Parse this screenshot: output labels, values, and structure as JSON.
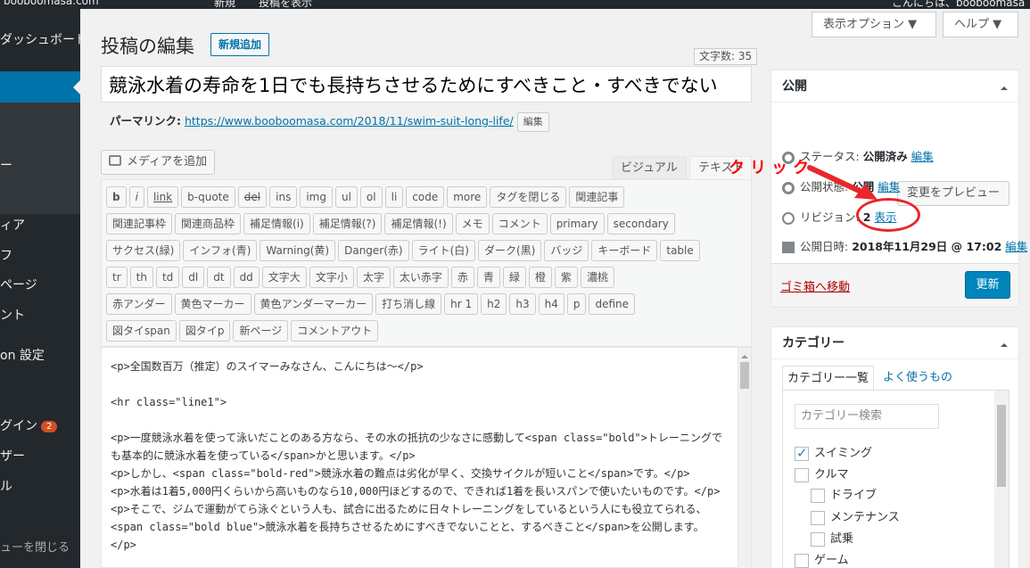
{
  "adminbar": {
    "site": "booboomasa.com",
    "new": "新規",
    "view_post": "投稿を表示",
    "greeting": "こんにちは、booboomasa さん"
  },
  "sidebar": {
    "items": [
      {
        "label": "ダッシュボード"
      },
      {
        "label": ""
      },
      {
        "label": "ー"
      },
      {
        "label": "ィア"
      },
      {
        "label": "フ"
      },
      {
        "label": "ページ"
      },
      {
        "label": "ント"
      },
      {
        "label": "on 設定"
      },
      {
        "label": "グイン",
        "badge": "2"
      },
      {
        "label": "ザー"
      },
      {
        "label": "ル"
      },
      {
        "label": "ューを閉じる"
      }
    ]
  },
  "top_buttons": {
    "screen_options": "表示オプション ▼",
    "help": "ヘルプ ▼"
  },
  "header": {
    "title": "投稿の編集",
    "add_new": "新規追加"
  },
  "word_count": "文字数: 35",
  "post_title": "競泳水着の寿命を1日でも長持ちさせるためにすべきこと・すべきでない",
  "permalink": {
    "label": "パーマリンク:",
    "url": "https://www.booboomasa.com/2018/11/swim-suit-long-life/",
    "edit": "編集"
  },
  "media_button": "メディアを追加",
  "editor_tabs": {
    "visual": "ビジュアル",
    "text": "テキスト"
  },
  "quicktags": [
    [
      "b",
      "i",
      "link",
      "b-quote",
      "del",
      "ins",
      "img",
      "ul",
      "ol",
      "li",
      "code",
      "more",
      "タグを閉じる",
      "関連記事"
    ],
    [
      "関連記事枠",
      "関連商品枠",
      "補足情報(i)",
      "補足情報(?)",
      "補足情報(!)",
      "メモ",
      "コメント",
      "primary",
      "secondary"
    ],
    [
      "サクセス(緑)",
      "インフォ(青)",
      "Warning(黄)",
      "Danger(赤)",
      "ライト(白)",
      "ダーク(黒)",
      "バッジ",
      "キーボード",
      "table"
    ],
    [
      "tr",
      "th",
      "td",
      "dl",
      "dt",
      "dd",
      "文字大",
      "文字小",
      "太字",
      "太い赤字",
      "赤",
      "青",
      "緑",
      "橙",
      "紫",
      "濃桃"
    ],
    [
      "赤アンダー",
      "黄色マーカー",
      "黄色アンダーマーカー",
      "打ち消し線",
      "hr 1",
      "h2",
      "h3",
      "h4",
      "p",
      "define"
    ],
    [
      "図タイspan",
      "図タイp",
      "新ページ",
      "コメントアウト"
    ]
  ],
  "editor_lines": [
    "<p>全国数百万（推定）のスイマーみなさん、こんにちは〜</p>",
    "",
    "<hr class=\"line1\">",
    "",
    "<p>一度競泳水着を使って泳いだことのある方なら、その水の抵抗の少なさに感動して<span class=\"bold\">トレーニングでも基本的に競泳水着を使っている</span>かと思います。</p>",
    "<p>しかし、<span class=\"bold-red\">競泳水着の難点は劣化が早く、交換サイクルが短いこと</span>です。</p>",
    "<p>水着は1着5,000円くらいから高いものなら10,000円ほどするので、できれば1着を長いスパンで使いたいものです。</p>",
    "<p>そこで、ジムで運動がてら泳ぐという人も、試合に出るために日々トレーニングをしているという人にも役立てられる、<span class=\"bold blue\">競泳水着を長持ちさせるためにすべきでないことと、するべきこと</span>を公開します。</p>"
  ],
  "publish": {
    "title": "公開",
    "preview": "変更をプレビュー",
    "status_label": "ステータス:",
    "status_value": "公開済み",
    "status_edit": "編集",
    "visibility_label": "公開状態:",
    "visibility_value": "公開",
    "visibility_edit": "編集",
    "revision_label": "リビジョン:",
    "revision_count": "2",
    "revision_link": "表示",
    "date_label": "公開日時:",
    "date_value": "2018年11月29日 @ 17:02",
    "date_edit": "編集",
    "trash": "ゴミ箱へ移動",
    "update": "更新"
  },
  "annotation": "クリック",
  "categories": {
    "title": "カテゴリー",
    "tab_all": "カテゴリー一覧",
    "tab_popular": "よく使うもの",
    "search_placeholder": "カテゴリー検索",
    "items": [
      {
        "label": "スイミング",
        "checked": true
      },
      {
        "label": "クルマ",
        "checked": false
      },
      {
        "label": "ドライブ",
        "checked": false
      },
      {
        "label": "メンテナンス",
        "checked": false
      },
      {
        "label": "試乗",
        "checked": false
      },
      {
        "label": "ゲーム",
        "checked": false
      }
    ]
  },
  "colors": {
    "accent": "#0073aa",
    "annotation": "#e8262b",
    "sidebar": "#23282d"
  }
}
